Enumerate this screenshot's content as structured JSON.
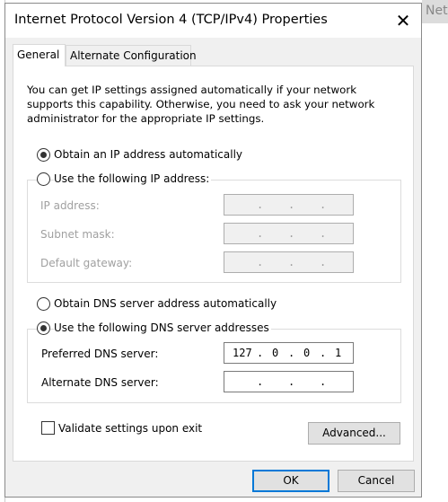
{
  "background": {
    "window_title_fragment": "Netw"
  },
  "dialog": {
    "title": "Internet Protocol Version 4 (TCP/IPv4) Properties",
    "close_icon": "close-icon",
    "tabs": [
      {
        "label": "General",
        "active": true
      },
      {
        "label": "Alternate Configuration",
        "active": false
      }
    ],
    "description": "You can get IP settings assigned automatically if your network supports this capability. Otherwise, you need to ask your network administrator for the appropriate IP settings.",
    "ip_mode": {
      "auto_label": "Obtain an IP address automatically",
      "auto_selected": true,
      "manual_label": "Use the following IP address:",
      "manual_selected": false
    },
    "ip_fields": [
      {
        "label": "IP address:",
        "octets": [
          "",
          "",
          "",
          ""
        ]
      },
      {
        "label": "Subnet mask:",
        "octets": [
          "",
          "",
          "",
          ""
        ]
      },
      {
        "label": "Default gateway:",
        "octets": [
          "",
          "",
          "",
          ""
        ]
      }
    ],
    "dns_mode": {
      "auto_label": "Obtain DNS server address automatically",
      "auto_selected": false,
      "manual_label": "Use the following DNS server addresses",
      "manual_selected": true
    },
    "dns_fields": [
      {
        "label": "Preferred DNS server:",
        "octets": [
          "127",
          "0",
          "0",
          "1"
        ]
      },
      {
        "label": "Alternate DNS server:",
        "octets": [
          "",
          "",
          "",
          ""
        ]
      }
    ],
    "validate_label": "Validate settings upon exit",
    "validate_checked": false,
    "advanced_label": "Advanced...",
    "ok_label": "OK",
    "cancel_label": "Cancel"
  },
  "colors": {
    "focus": "#0078d7",
    "face": "#f0f0f0"
  }
}
